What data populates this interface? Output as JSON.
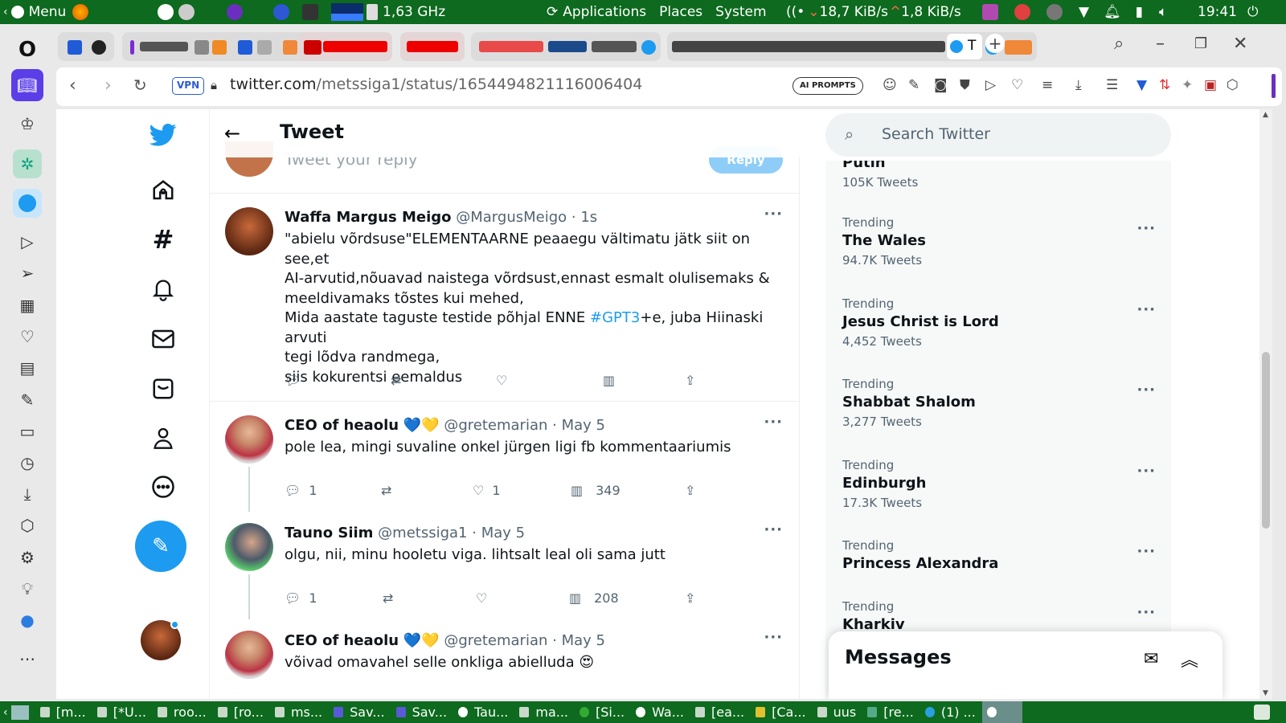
{
  "system_bar": {
    "menu_label": "Menu",
    "cpu_freq": "1,63 GHz",
    "applications": "Applications",
    "places": "Places",
    "system": "System",
    "net_down": "18,7 KiB/s",
    "net_up": "1,8 KiB/s",
    "clock": "19:41"
  },
  "browser": {
    "vpn_label": "VPN",
    "url_host": "twitter.com",
    "url_path": "/metssiga1/status/1654494821116006404",
    "ai_prompts_label": "AI PROMPTS",
    "active_tab_title": "T"
  },
  "twitter": {
    "header_title": "Tweet",
    "ghost_reply_placeholder": "Tweet your reply",
    "ghost_reply_button": "Reply",
    "search_placeholder": "Search Twitter",
    "messages_title": "Messages",
    "tweets": [
      {
        "name": "Waffa Margus Meigo",
        "handle": "@MargusMeigo",
        "time": "· 1s",
        "lines": [
          "\"abielu võrdsuse\"ELEMENTAARNE peaaegu vältimatu jätk siit on see,et",
          "AI-arvutid,nõuavad naistega võrdsust,ennast esmalt olulisemaks &",
          "meeldivamaks tõstes kui mehed,"
        ],
        "line4_pre": "Mida aastate taguste testide põhjal ENNE ",
        "line4_tag": "#GPT3",
        "line4_post": "+e, juba Hiinaski arvuti",
        "lines_end": [
          "tegi lõdva randmega,",
          "siis kokurentsi eemaldus"
        ]
      },
      {
        "name": "CEO of heaolu",
        "emoji": "💙💛",
        "handle": "@gretemarian",
        "time": "· May 5",
        "text": "pole lea, mingi suvaline onkel jürgen ligi fb kommentaariumis",
        "replies": "1",
        "likes": "1",
        "views": "349"
      },
      {
        "name": "Tauno Siim",
        "handle": "@metssiga1",
        "time": "· May 5",
        "text": "olgu, nii, minu hooletu viga. lihtsalt leal oli sama jutt",
        "replies": "1",
        "views": "208"
      },
      {
        "name": "CEO of heaolu",
        "emoji": "💙💛",
        "handle": "@gretemarian",
        "time": "· May 5",
        "text": "võivad omavahel selle onkliga abielluda 😍"
      }
    ],
    "trends": [
      {
        "label": "",
        "name": "Putin",
        "count": "105K Tweets"
      },
      {
        "label": "Trending",
        "name": "The Wales",
        "count": "94.7K Tweets"
      },
      {
        "label": "Trending",
        "name": "Jesus Christ is Lord",
        "count": "4,452 Tweets"
      },
      {
        "label": "Trending",
        "name": "Shabbat Shalom",
        "count": "3,277 Tweets"
      },
      {
        "label": "Trending",
        "name": "Edinburgh",
        "count": "17.3K Tweets"
      },
      {
        "label": "Trending",
        "name": "Princess Alexandra",
        "count": ""
      },
      {
        "label": "Trending",
        "name": "Kharkiv",
        "count": ""
      }
    ]
  },
  "taskbar": [
    "[m...",
    "[*U...",
    "roo...",
    "[ro...",
    "ms...",
    "Sav...",
    "Sav...",
    "Tau...",
    "ma...",
    "[Si...",
    "Wa...",
    "[ea...",
    "[Ca...",
    "uus",
    "[re...",
    "(1) ..."
  ],
  "colors": {
    "system_bar": "#0d6a1e",
    "twitter_blue": "#1d9bf0"
  }
}
